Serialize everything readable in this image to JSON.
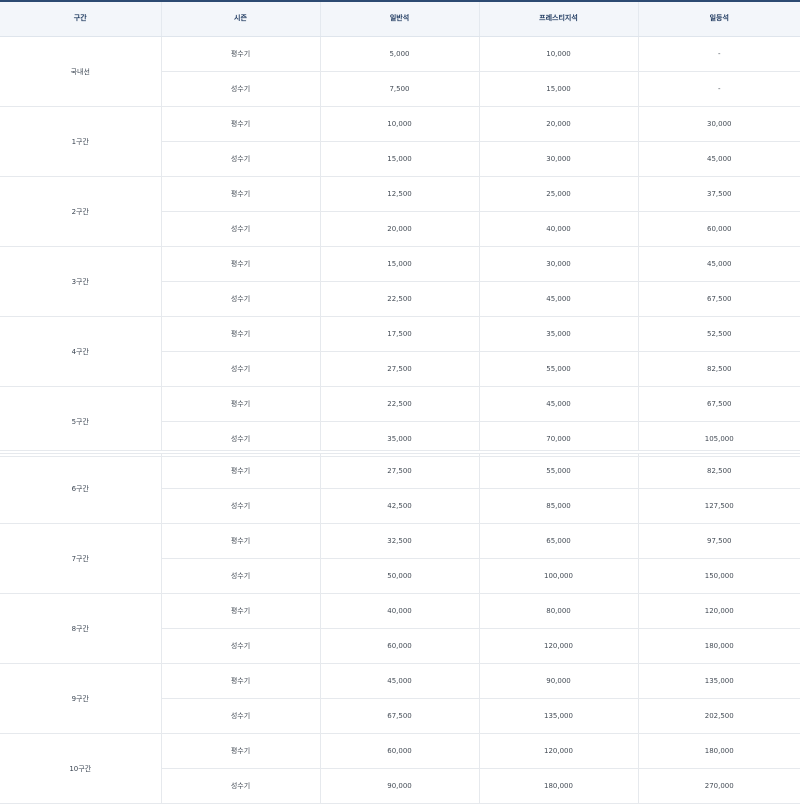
{
  "headers": [
    "구간",
    "시즌",
    "일반석",
    "프레스티지석",
    "일등석"
  ],
  "sections_top": [
    {
      "name": "국내선",
      "rows": [
        [
          "평수기",
          "5,000",
          "10,000",
          "-"
        ],
        [
          "성수기",
          "7,500",
          "15,000",
          "-"
        ]
      ]
    },
    {
      "name": "1구간",
      "rows": [
        [
          "평수기",
          "10,000",
          "20,000",
          "30,000"
        ],
        [
          "성수기",
          "15,000",
          "30,000",
          "45,000"
        ]
      ]
    },
    {
      "name": "2구간",
      "rows": [
        [
          "평수기",
          "12,500",
          "25,000",
          "37,500"
        ],
        [
          "성수기",
          "20,000",
          "40,000",
          "60,000"
        ]
      ]
    },
    {
      "name": "3구간",
      "rows": [
        [
          "평수기",
          "15,000",
          "30,000",
          "45,000"
        ],
        [
          "성수기",
          "22,500",
          "45,000",
          "67,500"
        ]
      ]
    },
    {
      "name": "4구간",
      "rows": [
        [
          "평수기",
          "17,500",
          "35,000",
          "52,500"
        ],
        [
          "성수기",
          "27,500",
          "55,000",
          "82,500"
        ]
      ]
    },
    {
      "name": "5구간",
      "rows": [
        [
          "평수기",
          "22,500",
          "45,000",
          "67,500"
        ],
        [
          "성수기",
          "35,000",
          "70,000",
          "105,000"
        ]
      ]
    }
  ],
  "sections_bottom": [
    {
      "name": "6구간",
      "rows": [
        [
          "평수기",
          "27,500",
          "55,000",
          "82,500"
        ],
        [
          "성수기",
          "42,500",
          "85,000",
          "127,500"
        ]
      ]
    },
    {
      "name": "7구간",
      "rows": [
        [
          "평수기",
          "32,500",
          "65,000",
          "97,500"
        ],
        [
          "성수기",
          "50,000",
          "100,000",
          "150,000"
        ]
      ]
    },
    {
      "name": "8구간",
      "rows": [
        [
          "평수기",
          "40,000",
          "80,000",
          "120,000"
        ],
        [
          "성수기",
          "60,000",
          "120,000",
          "180,000"
        ]
      ]
    },
    {
      "name": "9구간",
      "rows": [
        [
          "평수기",
          "45,000",
          "90,000",
          "135,000"
        ],
        [
          "성수기",
          "67,500",
          "135,000",
          "202,500"
        ]
      ]
    },
    {
      "name": "10구간",
      "rows": [
        [
          "평수기",
          "60,000",
          "120,000",
          "180,000"
        ],
        [
          "성수기",
          "90,000",
          "180,000",
          "270,000"
        ]
      ]
    }
  ]
}
